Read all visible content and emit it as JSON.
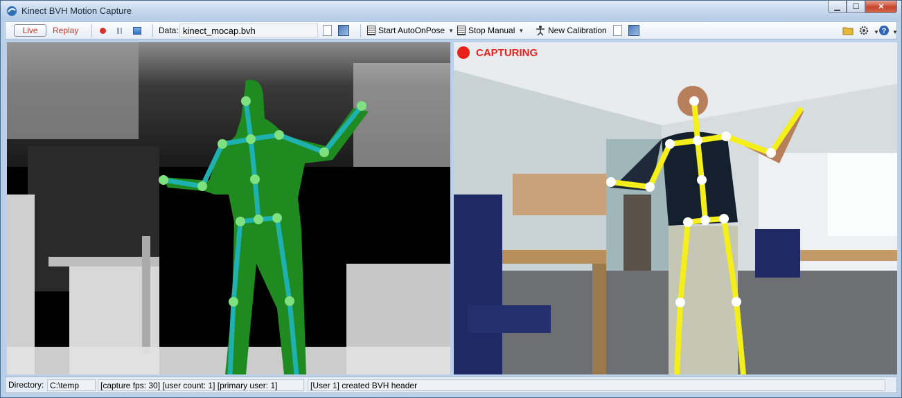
{
  "window": {
    "title": "Kinect BVH Motion Capture",
    "minimize": "▁",
    "maximize": "☐",
    "close": "✕"
  },
  "toolbar": {
    "live_label": "Live",
    "replay_label": "Replay",
    "data_label": "Data:",
    "data_value": "kinect_mocap.bvh",
    "autopose_label": "Start AutoOnPose",
    "manual_label": "Stop Manual",
    "calibration_label": "New Calibration"
  },
  "camera": {
    "status": "CAPTURING"
  },
  "statusbar": {
    "directory_label": "Directory:",
    "directory_value": "C:\\temp",
    "capture_info": "[capture fps: 30]  [user count: 1]  [primary user: 1]",
    "log": "[User 1] created BVH header"
  },
  "colors": {
    "depth_skeleton": "#1fb0b0",
    "depth_silhouette": "#1f8a1f",
    "rgb_skeleton": "#f4ee1a",
    "capturing": "#e8221b"
  }
}
